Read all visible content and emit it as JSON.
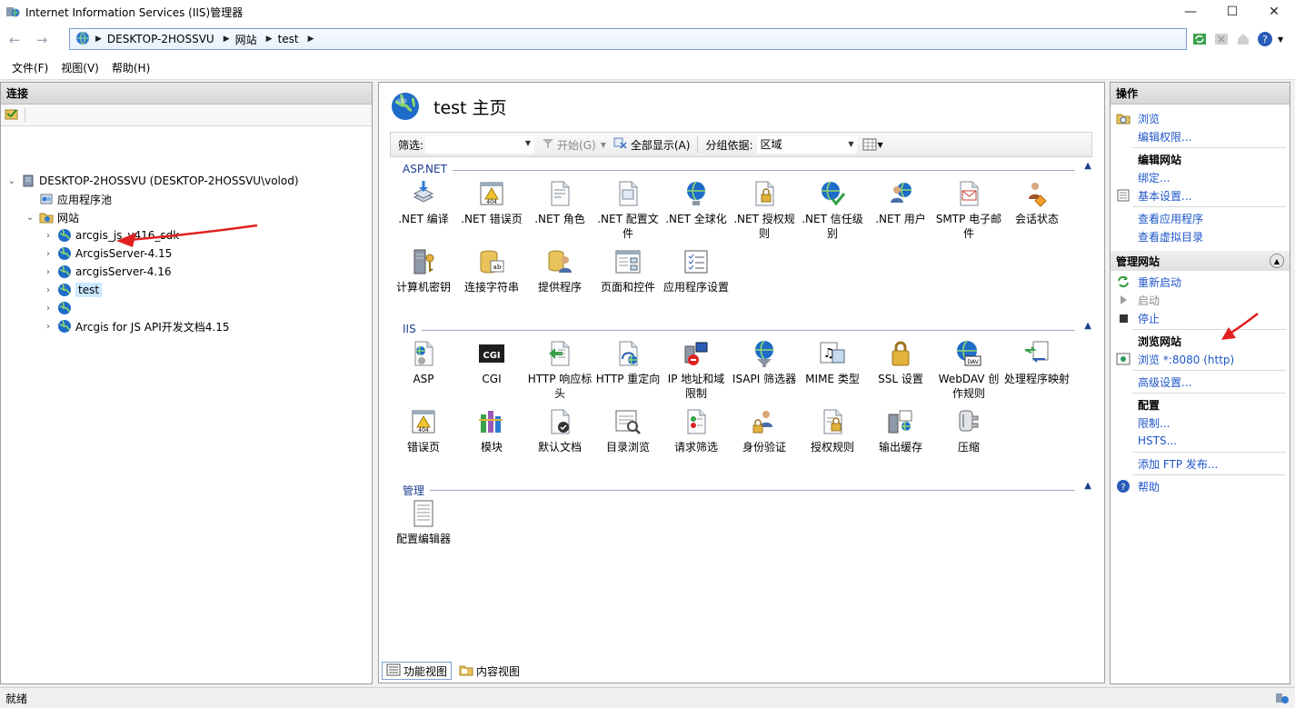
{
  "window": {
    "title": "Internet Information Services (IIS)管理器",
    "minimize": "—",
    "maximize": "☐",
    "close": "✕"
  },
  "address": {
    "segments": [
      "DESKTOP-2HOSSVU",
      "网站",
      "test"
    ]
  },
  "menu": [
    "文件(F)",
    "视图(V)",
    "帮助(H)"
  ],
  "connections": {
    "header": "连接",
    "tree": [
      {
        "label": "DESKTOP-2HOSSVU (DESKTOP-2HOSSVU\\volod)",
        "icon": "server-icon",
        "level": 0,
        "expander": "⌄"
      },
      {
        "label": "应用程序池",
        "icon": "app-pool-icon",
        "level": 1,
        "expander": ""
      },
      {
        "label": "网站",
        "icon": "sites-folder-icon",
        "level": 1,
        "expander": "⌄"
      },
      {
        "label": "arcgis_js_v416_sdk",
        "icon": "globe-icon",
        "level": 2,
        "expander": "›"
      },
      {
        "label": "ArcgisServer-4.15",
        "icon": "globe-icon",
        "level": 2,
        "expander": "›"
      },
      {
        "label": "arcgisServer-4.16",
        "icon": "globe-icon",
        "level": 2,
        "expander": "›"
      },
      {
        "label": "test",
        "icon": "globe-icon",
        "level": 2,
        "expander": "›",
        "selected": true
      },
      {
        "label": "",
        "icon": "globe-icon",
        "level": 2,
        "expander": "›"
      },
      {
        "label": "Arcgis for JS API开发文档4.15",
        "icon": "globe-icon",
        "level": 2,
        "expander": "›"
      }
    ]
  },
  "main": {
    "title": "test 主页",
    "filter": {
      "label": "筛选:",
      "value": "",
      "start": "开始(G)",
      "show_all": "全部显示(A)",
      "group_by_label": "分组依据:",
      "group_by_value": "区域"
    },
    "sections": [
      {
        "name": "ASP.NET",
        "items": [
          {
            "label": ".NET 编译",
            "icon": "net-compile-icon"
          },
          {
            "label": ".NET 错误页",
            "icon": "net-error-page-icon"
          },
          {
            "label": ".NET 角色",
            "icon": "net-roles-icon"
          },
          {
            "label": ".NET 配置文件",
            "icon": "net-profile-icon"
          },
          {
            "label": ".NET 全球化",
            "icon": "net-globalization-icon"
          },
          {
            "label": ".NET 授权规则",
            "icon": "net-authorization-icon"
          },
          {
            "label": ".NET 信任级别",
            "icon": "net-trust-level-icon"
          },
          {
            "label": ".NET 用户",
            "icon": "net-users-icon"
          },
          {
            "label": "SMTP 电子邮件",
            "icon": "smtp-email-icon"
          },
          {
            "label": "会话状态",
            "icon": "session-state-icon"
          },
          {
            "label": "计算机密钥",
            "icon": "machine-key-icon"
          },
          {
            "label": "连接字符串",
            "icon": "connection-strings-icon"
          },
          {
            "label": "提供程序",
            "icon": "providers-icon"
          },
          {
            "label": "页面和控件",
            "icon": "pages-controls-icon"
          },
          {
            "label": "应用程序设置",
            "icon": "app-settings-icon"
          }
        ]
      },
      {
        "name": "IIS",
        "items": [
          {
            "label": "ASP",
            "icon": "asp-icon"
          },
          {
            "label": "CGI",
            "icon": "cgi-icon"
          },
          {
            "label": "HTTP 响应标头",
            "icon": "http-response-headers-icon"
          },
          {
            "label": "HTTP 重定向",
            "icon": "http-redirect-icon"
          },
          {
            "label": "IP 地址和域限制",
            "icon": "ip-restrictions-icon"
          },
          {
            "label": "ISAPI 筛选器",
            "icon": "isapi-filters-icon"
          },
          {
            "label": "MIME 类型",
            "icon": "mime-types-icon"
          },
          {
            "label": "SSL 设置",
            "icon": "ssl-settings-icon"
          },
          {
            "label": "WebDAV 创作规则",
            "icon": "webdav-icon"
          },
          {
            "label": "处理程序映射",
            "icon": "handler-mappings-icon"
          },
          {
            "label": "错误页",
            "icon": "error-pages-icon"
          },
          {
            "label": "模块",
            "icon": "modules-icon"
          },
          {
            "label": "默认文档",
            "icon": "default-document-icon"
          },
          {
            "label": "目录浏览",
            "icon": "directory-browsing-icon"
          },
          {
            "label": "请求筛选",
            "icon": "request-filtering-icon"
          },
          {
            "label": "身份验证",
            "icon": "authentication-icon"
          },
          {
            "label": "授权规则",
            "icon": "authorization-rules-icon"
          },
          {
            "label": "输出缓存",
            "icon": "output-caching-icon"
          },
          {
            "label": "压缩",
            "icon": "compression-icon"
          }
        ]
      },
      {
        "name": "管理",
        "items": [
          {
            "label": "配置编辑器",
            "icon": "configuration-editor-icon"
          }
        ]
      }
    ],
    "tabs": [
      {
        "label": "功能视图",
        "active": true
      },
      {
        "label": "内容视图",
        "active": false
      }
    ]
  },
  "actions": {
    "header": "操作",
    "explore": "浏览",
    "edit_permissions": "编辑权限...",
    "edit_site": "编辑网站",
    "bindings": "绑定...",
    "basic_settings": "基本设置...",
    "view_applications": "查看应用程序",
    "view_virtual_dirs": "查看虚拟目录",
    "manage_site": "管理网站",
    "restart": "重新启动",
    "start": "启动",
    "stop": "停止",
    "browse_site": "浏览网站",
    "browse_8080": "浏览 *:8080 (http)",
    "advanced_settings": "高级设置...",
    "configure": "配置",
    "limits": "限制...",
    "hsts": "HSTS...",
    "add_ftp": "添加 FTP 发布...",
    "help": "帮助"
  },
  "status": {
    "text": "就绪"
  },
  "colors": {
    "link": "#1f56c8",
    "section_title": "#1a3d8f",
    "selection": "#cce8ff",
    "annotation_arrow": "#e02020"
  }
}
